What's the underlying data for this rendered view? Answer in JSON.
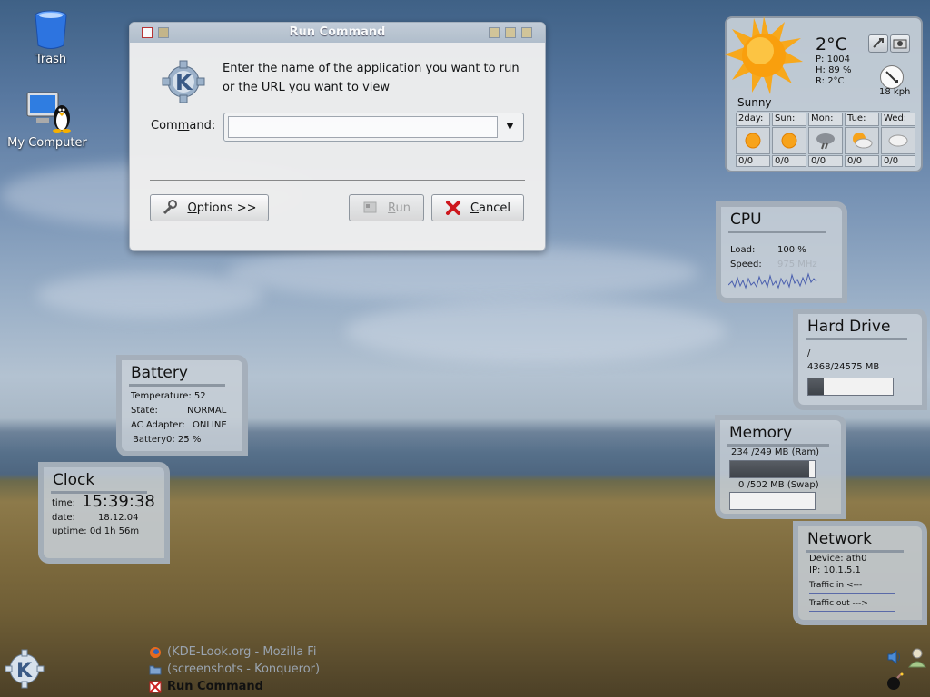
{
  "desktop": {
    "icons": [
      {
        "label": "Trash"
      },
      {
        "label": "My Computer"
      }
    ]
  },
  "run_dialog": {
    "title": "Run Command",
    "prompt": "Enter the name of the application you want to run or the URL you want to view",
    "command_label_pre": "Com",
    "command_label_key": "m",
    "command_label_post": "and:",
    "command_value": "",
    "options_label_key": "O",
    "options_label_rest": "ptions >>",
    "run_label_key": "R",
    "run_label_rest": "un",
    "cancel_label_key": "C",
    "cancel_label_rest": "ancel"
  },
  "weather": {
    "temperature": "2°C",
    "pressure": "P:  1004",
    "humidity": "H:  89 %",
    "real_feel": "R:  2°C",
    "wind": "18 kph",
    "condition": "Sunny",
    "forecast": [
      {
        "day": "2day:",
        "value": "0/0",
        "icon": "sunny-icon"
      },
      {
        "day": "Sun:",
        "value": "0/0",
        "icon": "sunny-icon"
      },
      {
        "day": "Mon:",
        "value": "0/0",
        "icon": "storm-icon"
      },
      {
        "day": "Tue:",
        "value": "0/0",
        "icon": "partly-cloudy-icon"
      },
      {
        "day": "Wed:",
        "value": "0/0",
        "icon": "cloudy-icon"
      }
    ]
  },
  "cpu": {
    "title": "CPU",
    "load_label": "Load:",
    "load_value": "100 %",
    "speed_label": "Speed:",
    "speed_value": "975 MHz"
  },
  "hard_drive": {
    "title": "Hard Drive",
    "mount": "/",
    "usage": "4368/24575 MB",
    "used_fraction": 0.18
  },
  "memory": {
    "title": "Memory",
    "ram": "234 /249 MB (Ram)",
    "ram_fraction": 0.94,
    "swap": "0 /502 MB (Swap)",
    "swap_fraction": 0.0
  },
  "network": {
    "title": "Network",
    "device": "Device: ath0",
    "ip": "IP:  10.1.5.1",
    "traffic_in": "Traffic in  <---",
    "traffic_out": "Traffic out --->"
  },
  "battery": {
    "title": "Battery",
    "temperature": "Temperature: 52",
    "state_label": "State:",
    "state_value": "NORMAL",
    "adapter_label": "AC Adapter:",
    "adapter_value": "ONLINE",
    "battery0": "Battery0: 25 %"
  },
  "clock": {
    "title": "Clock",
    "time_label": "time:",
    "time_value": "15:39:38",
    "date_label": "date:",
    "date_value": "18.12.04",
    "uptime": "uptime:  0d 1h 56m"
  },
  "taskbar": {
    "tasks": [
      {
        "label": "(KDE-Look.org - Mozilla Fi",
        "icon": "firefox-icon"
      },
      {
        "label": "(screenshots - Konqueror)",
        "icon": "folder-icon"
      },
      {
        "label": "Run Command",
        "icon": "run-icon"
      }
    ]
  }
}
